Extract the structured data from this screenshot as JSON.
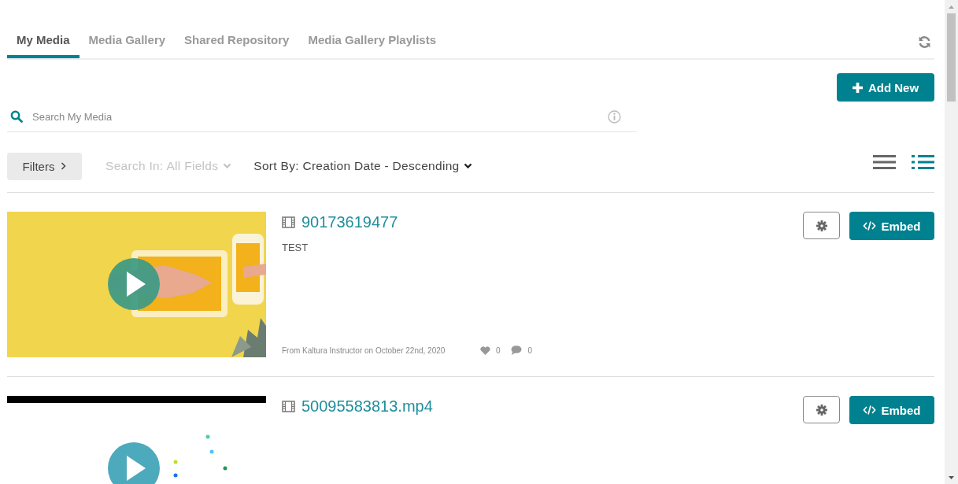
{
  "tabs": [
    {
      "label": "My Media",
      "selected": true
    },
    {
      "label": "Media Gallery",
      "selected": false
    },
    {
      "label": "Shared Repository",
      "selected": false
    },
    {
      "label": "Media Gallery Playlists",
      "selected": false
    }
  ],
  "add_button": {
    "label": "Add New"
  },
  "search": {
    "placeholder": "Search My Media"
  },
  "filters_button": {
    "label": "Filters"
  },
  "search_in": {
    "label": "Search In: All Fields",
    "disabled": true
  },
  "sort": {
    "label": "Sort By: Creation Date - Descending"
  },
  "views": [
    {
      "kind": "compact",
      "selected": false
    },
    {
      "kind": "detailed",
      "selected": true
    }
  ],
  "media": [
    {
      "title": "90173619477",
      "description": "TEST",
      "meta": "From Kaltura Instructor on October 22nd, 2020",
      "likes": "0",
      "comments": "0",
      "embed_label": "Embed"
    },
    {
      "title": "50095583813.mp4",
      "embed_label": "Embed"
    }
  ]
}
